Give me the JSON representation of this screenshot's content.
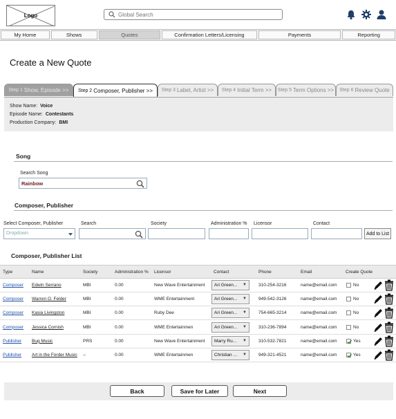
{
  "header": {
    "logo_text": "Logo",
    "search_placeholder": "Global Search"
  },
  "nav": [
    {
      "label": "My Home"
    },
    {
      "label": "Shows"
    },
    {
      "label": "Quotes"
    },
    {
      "label": "Confirmation Letters/Licensing"
    },
    {
      "label": "Payments"
    },
    {
      "label": "Reporting"
    }
  ],
  "page": {
    "title": "Create a New Quote"
  },
  "steps": [
    {
      "num": "Step 1",
      "name": "Show, Episode >>"
    },
    {
      "num": "Step 2",
      "name": "Composer, Publisher >>"
    },
    {
      "num": "Step 3",
      "name": "Label, Artist >>"
    },
    {
      "num": "Step 4",
      "name": "Initial Term >>"
    },
    {
      "num": "Step 5",
      "name": "Term Options >>"
    },
    {
      "num": "Step 6",
      "name": "Review Quote"
    }
  ],
  "info": {
    "show_label": "Show Name:",
    "show_value": "Voice",
    "episode_label": "Episode Name:",
    "episode_value": "Contestants",
    "company_label": "Production Company:",
    "company_value": "BMI"
  },
  "song": {
    "section_title": "Song",
    "search_label": "Search Song",
    "search_value": "Rainbow"
  },
  "composer": {
    "section_title": "Composer, Publisher",
    "select_label": "Select Composer, Publisher",
    "select_value": "Dropdown",
    "search_label": "Search",
    "society_label": "Society",
    "admin_label": "Administration %",
    "licensor_label": "Licensor",
    "contact_label": "Contact",
    "add_button": "Add to List"
  },
  "list": {
    "title": "Composer, Publisher List",
    "columns": [
      "Type",
      "Name",
      "Society",
      "Administration %",
      "Licensor",
      "Contact",
      "Phone",
      "Email",
      "Create Quote"
    ],
    "rows": [
      {
        "type": "Composer",
        "name": "Edwin Serrano",
        "society": "MBI",
        "admin": "0.00",
        "licensor": "New Wave Entertainment",
        "contact": "Ari Green...",
        "phone": "310-254-3216",
        "email": "name@email.com",
        "checked": false,
        "quote": "No"
      },
      {
        "type": "Composer",
        "name": "Warren O. Felder",
        "society": "MBI",
        "admin": "0.00",
        "licensor": "WME Entertainment",
        "contact": "Ari Green...",
        "phone": "949-542-3126",
        "email": "name@email.com",
        "checked": false,
        "quote": "No"
      },
      {
        "type": "Composer",
        "name": "Kasia Livingston",
        "society": "MBI",
        "admin": "0.00",
        "licensor": "Ruby Dee",
        "contact": "Ari Green...",
        "phone": "754-665-3214",
        "email": "name@email.com",
        "checked": false,
        "quote": "No"
      },
      {
        "type": "Composer",
        "name": "Jessica Cornish",
        "society": "MBI",
        "admin": "0.00",
        "licensor": "WME Entertainmen",
        "contact": "Ari Green...",
        "phone": "310-236-7894",
        "email": "name@email.com",
        "checked": false,
        "quote": "No"
      },
      {
        "type": "Publisher",
        "name": "Bug Music",
        "society": "PRS",
        "admin": "0.00",
        "licensor": "New Wave Entertainment",
        "contact": "Marry Ru...",
        "phone": "310-532-7821",
        "email": "name@email.com",
        "checked": true,
        "quote": "Yes"
      },
      {
        "type": "Publisher",
        "name": "Art in the Forder Music",
        "society": "--",
        "admin": "0.00",
        "licensor": "WME Entertainmen",
        "contact": "Christian ...",
        "phone": "949-321-4521",
        "email": "name@email.com",
        "checked": true,
        "quote": "Yes"
      }
    ]
  },
  "footer": {
    "back": "Back",
    "save": "Save for Later",
    "next": "Next"
  }
}
